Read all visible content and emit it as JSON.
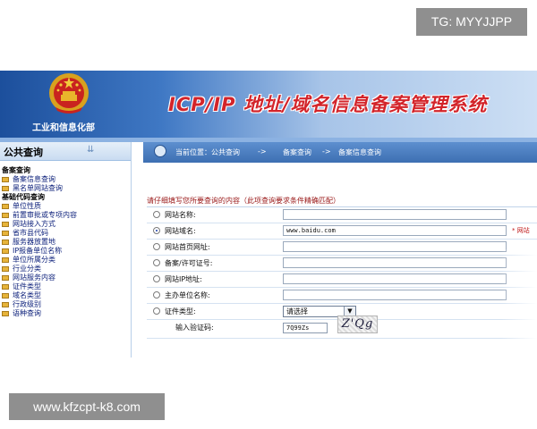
{
  "overlay": {
    "top_right": "TG: MYYJJPP",
    "bottom_left": "www.kfzcpt-k8.com"
  },
  "header": {
    "ministry": "工业和信息化部",
    "system_title": "ICP/IP 地址/域名信息备案管理系统",
    "emblem_icon": "national-emblem-icon"
  },
  "sidebar": {
    "title": "公共查询",
    "collapse_icon": "double-chevron-down-icon",
    "sections": [
      {
        "category": "备案查询",
        "items": [
          "备案信息查询",
          "黑名单网站查询"
        ]
      },
      {
        "category": "基础代码查询",
        "items": [
          "单位性质",
          "前置审批或专项内容",
          "网站接入方式",
          "省市县代码",
          "服务器放置地",
          "IP报备单位名称",
          "单位所属分类",
          "行业分类",
          "网站服务内容",
          "证件类型",
          "域名类型",
          "行政级别",
          "语种查询"
        ]
      }
    ]
  },
  "breadcrumb": {
    "current_label": "当前位置：公共查询",
    "sep1": "->",
    "step1": "备案查询",
    "sep2": "->",
    "step2": "备案信息查询"
  },
  "form": {
    "notice": "请仔细填写您所要查询的内容（此项查询要求条件精确匹配）",
    "fields": [
      {
        "label": "网站名称:",
        "value": "",
        "selected": false
      },
      {
        "label": "网站域名:",
        "value": "www.baidu.com",
        "selected": true,
        "required_note": "* 网站"
      },
      {
        "label": "网站首页网址:",
        "value": "",
        "selected": false
      },
      {
        "label": "备案/许可证号:",
        "value": "",
        "selected": false
      },
      {
        "label": "网站IP地址:",
        "value": "",
        "selected": false
      },
      {
        "label": "主办单位名称:",
        "value": "",
        "selected": false
      }
    ],
    "cert_type": {
      "label": "证件类型:",
      "selected": "请选择"
    },
    "captcha": {
      "label": "输入验证码:",
      "value": "7Q99Zs",
      "image_text": "Z'Qg"
    }
  },
  "colors": {
    "header_blue": "#1c4f9c",
    "title_red": "#d3242a",
    "link_blue": "#0b1f7a",
    "notice_red": "#9a1818"
  }
}
